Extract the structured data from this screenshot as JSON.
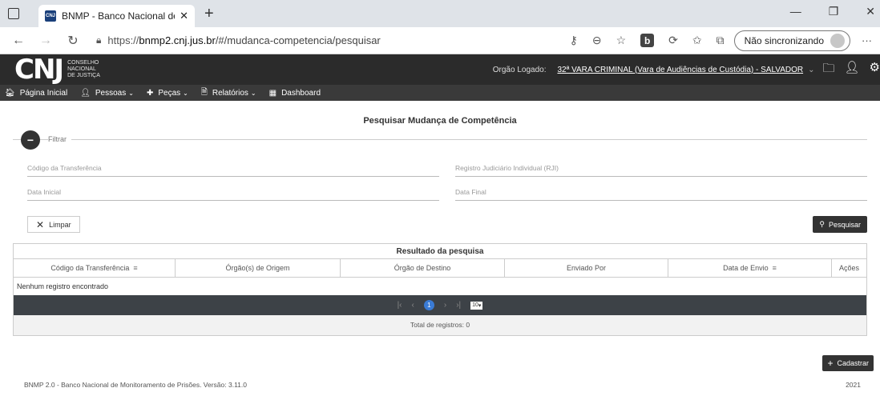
{
  "browser": {
    "tab_title": "BNMP - Banco Nacional de Man",
    "favicon_text": "CNJ",
    "url_domain": "bnmp2.cnj.jus.br",
    "url_prefix": "https://",
    "url_path": "/#/mudanca-competencia/pesquisar",
    "sync_label": "Não sincronizando"
  },
  "header": {
    "logo": "CNJ",
    "logo_sub_1": "CONSELHO",
    "logo_sub_2": "NACIONAL",
    "logo_sub_3": "DE JUSTIÇA",
    "orgao_label": "Orgão Logado:",
    "orgao_value": "32ª VARA CRIMINAL (Vara de Audiências de Custódia) - SALVADOR"
  },
  "menu": {
    "items": [
      {
        "label": "Página Inicial"
      },
      {
        "label": "Pessoas"
      },
      {
        "label": "Peças"
      },
      {
        "label": "Relatórios"
      },
      {
        "label": "Dashboard"
      }
    ]
  },
  "page": {
    "title": "Pesquisar Mudança de Competência"
  },
  "filter": {
    "label": "Filtrar",
    "codigo_placeholder": "Código da Transferência",
    "rji_placeholder": "Registro Judiciário Individual (RJI)",
    "data_inicial_placeholder": "Data Inicial",
    "data_final_placeholder": "Data Final",
    "limpar_label": "Limpar",
    "pesquisar_label": "Pesquisar"
  },
  "results": {
    "title": "Resultado da pesquisa",
    "columns": [
      {
        "label": "Código da Transferência"
      },
      {
        "label": "Órgão(s) de Origem"
      },
      {
        "label": "Órgão de Destino"
      },
      {
        "label": "Enviado Por"
      },
      {
        "label": "Data de Envio"
      },
      {
        "label": "Ações"
      }
    ],
    "empty_text": "Nenhum registro encontrado",
    "pager": {
      "current_page": "1",
      "page_size": "10"
    },
    "total_text": "Total de registros: 0"
  },
  "actions": {
    "cadastrar_label": "Cadastrar"
  },
  "footer": {
    "left": "BNMP 2.0 - Banco Nacional de Monitoramento de Prisões. Versão: 3.11.0",
    "right": "2021"
  }
}
